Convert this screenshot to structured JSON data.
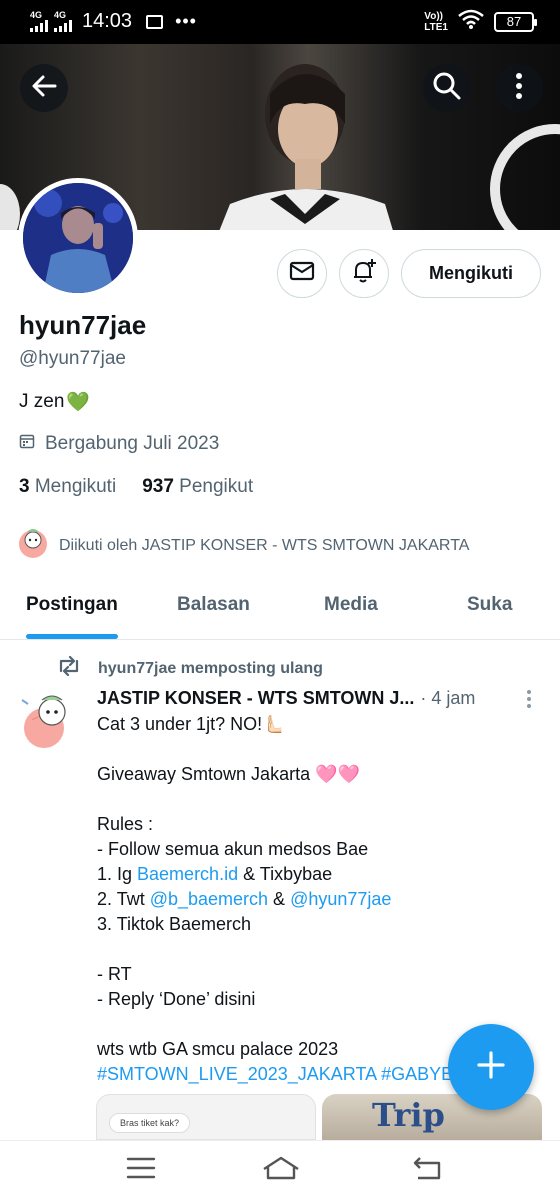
{
  "status_bar": {
    "net1": "4G",
    "net2": "4G",
    "time": "14:03",
    "more": "•••",
    "volte_top": "Vo))",
    "volte_bottom": "LTE1",
    "battery": "87"
  },
  "profile": {
    "name": "hyun77jae",
    "handle": "@hyun77jae",
    "bio": "J zen",
    "bio_emoji": "💚",
    "joined": "Bergabung Juli 2023",
    "following_count": "3",
    "following_label": "Mengikuti",
    "followers_count": "937",
    "followers_label": "Pengikut",
    "followed_by": "Diikuti oleh JASTIP KONSER - WTS SMTOWN JAKARTA",
    "follow_button": "Mengikuti"
  },
  "tabs": [
    "Postingan",
    "Balasan",
    "Media",
    "Suka"
  ],
  "post": {
    "repost_label": "hyun77jae memposting ulang",
    "author": "JASTIP KONSER - WTS SMTOWN J...",
    "time": "· 4 jam",
    "line1": "Cat 3 under 1jt? NO!🫷🏻",
    "line2": "Giveaway Smtown Jakarta 🩷🩷",
    "rules_title": "Rules :",
    "rule_follow": "- Follow semua akun medsos Bae",
    "rule1_prefix": "1. Ig ",
    "rule1_link": "Baemerch.id",
    "rule1_suffix": " & Tixbybae",
    "rule2_prefix": "2. Twt ",
    "rule2_link1": "@b_baemerch",
    "rule2_mid": " & ",
    "rule2_link2": "@hyun77jae",
    "rule3": "3. Tiktok Baemerch",
    "rt": "- RT",
    "reply": "- Reply ‘Done’ disini",
    "wts": "wts wtb GA smcu palace 2023",
    "hashtags": "#SMTOWN_LIVE_2023_JAKARTA #GABYE",
    "media1_chip": "Bras tiket kak?",
    "media2_text": "Trip"
  },
  "icons": {
    "back": "back-arrow-icon",
    "search": "search-icon",
    "more": "more-vertical-icon",
    "message": "envelope-icon",
    "notify": "bell-plus-icon",
    "calendar": "calendar-icon",
    "repost": "repost-icon",
    "compose": "plus-icon"
  },
  "colors": {
    "accent": "#1d9bf0",
    "secondary_text": "#536471",
    "primary_text": "#0f1419"
  }
}
